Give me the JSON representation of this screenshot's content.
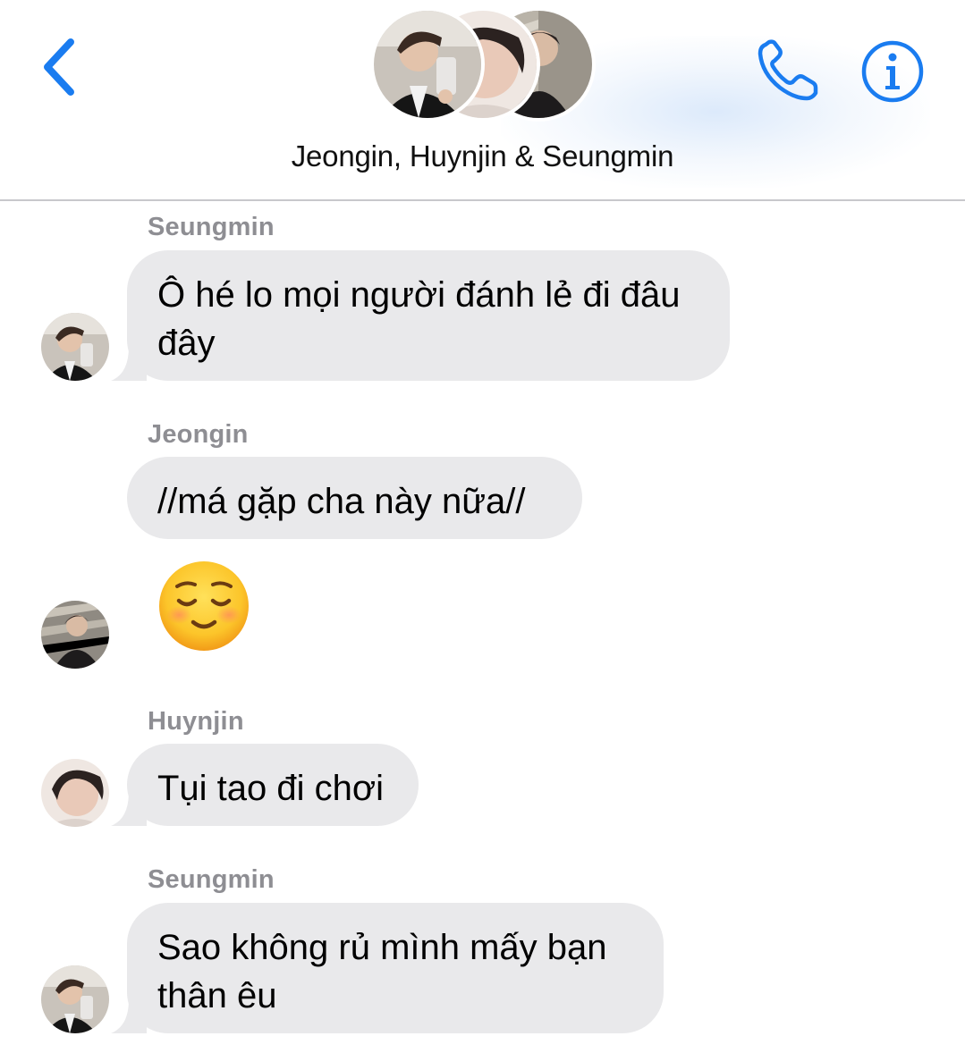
{
  "header": {
    "title": "Jeongin, Huynjin & Seungmin",
    "accent_color": "#1a7cf0",
    "back_icon": "chevron-left-icon",
    "call_icon": "phone-icon",
    "info_icon": "info-icon"
  },
  "messages": [
    {
      "sender": "Seungmin",
      "lines": [
        "Ô hé lo mọi người đánh lẻ đi đâu",
        "đây"
      ]
    },
    {
      "sender": "Jeongin",
      "lines": [
        "//má gặp cha này nữa//"
      ]
    },
    {
      "sender": "Jeongin",
      "emoji": "smiling-face-with-closed-eyes"
    },
    {
      "sender": "Huynjin",
      "lines": [
        "Tụi tao đi chơi"
      ]
    },
    {
      "sender": "Seungmin",
      "lines": [
        "Sao không rủ mình mấy bạn",
        "thân êu"
      ]
    }
  ],
  "colors": {
    "bubble_received": "#e9e9eb",
    "sender_name": "#8e8e93"
  }
}
